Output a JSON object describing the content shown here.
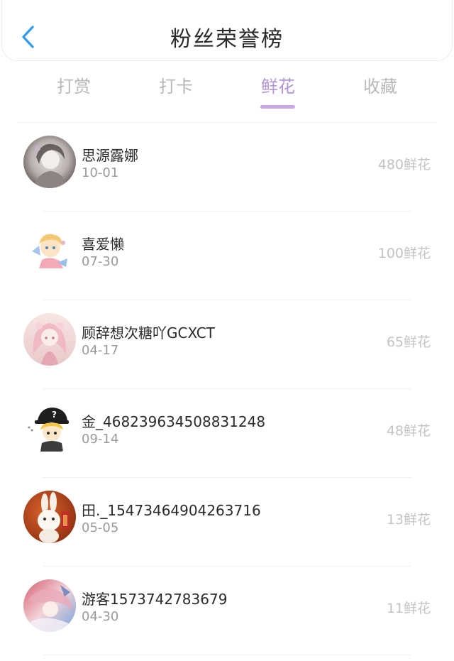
{
  "header": {
    "title": "粉丝荣誉榜",
    "back_icon": "chevron-left-icon",
    "accent": "#2d9cf0"
  },
  "tabs": [
    {
      "label": "打赏",
      "active": false
    },
    {
      "label": "打卡",
      "active": false
    },
    {
      "label": "鲜花",
      "active": true
    },
    {
      "label": "收藏",
      "active": false
    }
  ],
  "active_tab_color": "#b292d4",
  "fans": [
    {
      "name": "思源露娜",
      "date": "10-01",
      "amount": "480鲜花",
      "avatar": "girl-portrait-avatar"
    },
    {
      "name": "喜爱懒",
      "date": "07-30",
      "amount": "100鲜花",
      "avatar": "anime-chibi-avatar"
    },
    {
      "name": "顾辞想次糖吖GCXCT",
      "date": "04-17",
      "amount": "65鲜花",
      "avatar": "pink-anime-girl-avatar"
    },
    {
      "name": "金_468239634508831248",
      "date": "09-14",
      "amount": "48鲜花",
      "avatar": "cartoon-cap-avatar"
    },
    {
      "name": "田._15473464904263716",
      "date": "05-05",
      "amount": "13鲜花",
      "avatar": "rabbit-avatar"
    },
    {
      "name": "游客1573742783679",
      "date": "04-30",
      "amount": "11鲜花",
      "avatar": "anime-art-avatar"
    }
  ]
}
